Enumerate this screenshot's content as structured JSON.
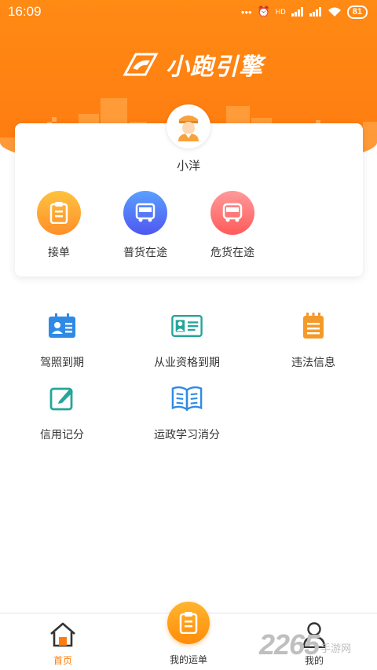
{
  "status_bar": {
    "time": "16:09",
    "battery": "81",
    "network": "HD"
  },
  "header": {
    "app_name": "小跑引擎"
  },
  "profile": {
    "name": "小洋"
  },
  "quick_actions": [
    {
      "label": "接单",
      "color_from": "#ffc23f",
      "color_to": "#ff8f2b"
    },
    {
      "label": "普货在途",
      "color_from": "#5aa0ff",
      "color_to": "#4f57f0"
    },
    {
      "label": "危货在途",
      "color_from": "#ff9a9a",
      "color_to": "#ff5b5b"
    }
  ],
  "services": [
    {
      "label": "驾照到期",
      "icon": "id-card-icon",
      "color": "#2f8ae5"
    },
    {
      "label": "从业资格到期",
      "icon": "certificate-icon",
      "color": "#26a59a"
    },
    {
      "label": "违法信息",
      "icon": "notepad-icon",
      "color": "#f39a2a"
    },
    {
      "label": "信用记分",
      "icon": "edit-icon",
      "color": "#26a59a"
    },
    {
      "label": "运政学习消分",
      "icon": "book-icon",
      "color": "#2f8ae5"
    }
  ],
  "tabbar": {
    "home": "首页",
    "orders": "我的运单",
    "mine": "我的",
    "active_color": "#ff7d0f"
  },
  "watermark": {
    "number": "2265",
    "text": "手游网"
  }
}
